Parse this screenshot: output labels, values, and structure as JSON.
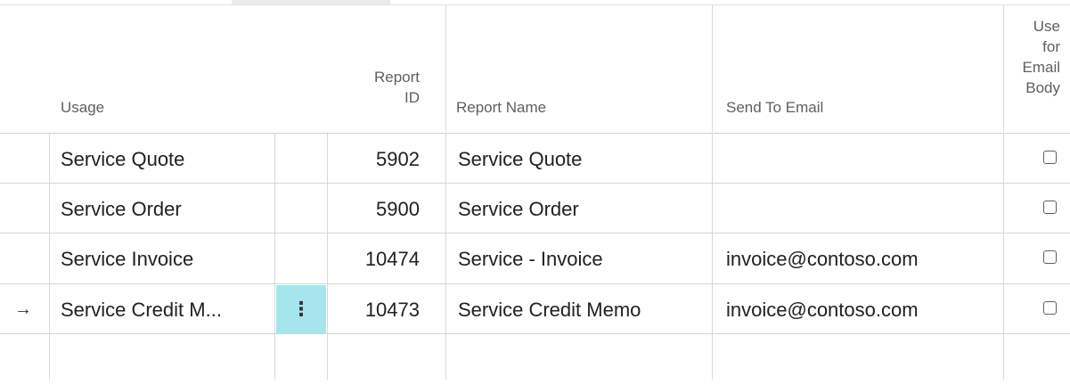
{
  "table": {
    "headers": {
      "usage": "Usage",
      "report_id": [
        "Report",
        "ID"
      ],
      "report_name": "Report Name",
      "send_to_email": "Send To Email",
      "use_for_email_body": [
        "Use",
        "for",
        "Email",
        "Body"
      ]
    },
    "rows": [
      {
        "usage": "Service Quote",
        "report_id": "5902",
        "report_name": "Service Quote",
        "send_to_email": "",
        "use_for_email_body": false,
        "selected": false
      },
      {
        "usage": "Service Order",
        "report_id": "5900",
        "report_name": "Service Order",
        "send_to_email": "",
        "use_for_email_body": false,
        "selected": false
      },
      {
        "usage": "Service Invoice",
        "report_id": "10474",
        "report_name": "Service - Invoice",
        "send_to_email": "invoice@contoso.com",
        "use_for_email_body": false,
        "selected": false
      },
      {
        "usage": "Service Credit M...",
        "report_id": "10473",
        "report_name": "Service Credit Memo",
        "send_to_email": "invoice@contoso.com",
        "use_for_email_body": false,
        "selected": true
      }
    ],
    "row_actions_glyph": "⋮",
    "current_row_glyph": "→"
  },
  "colors": {
    "action_button_bg": "#a6e5ec",
    "gridline": "#dadada",
    "header_text": "#5f5f5f"
  }
}
